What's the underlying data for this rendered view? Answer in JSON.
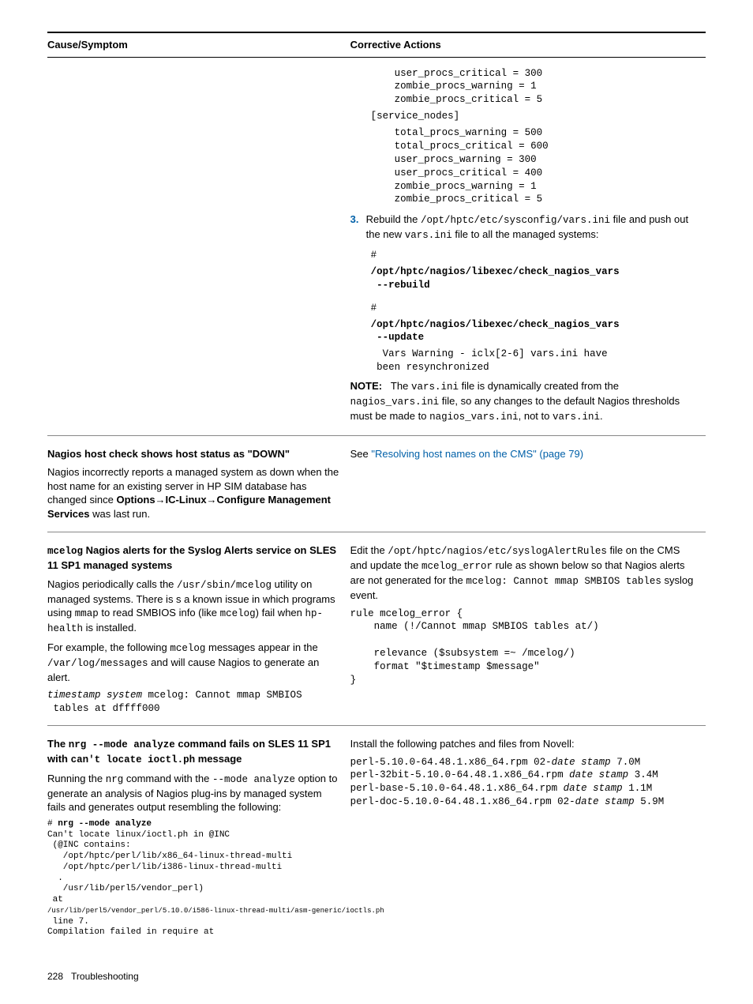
{
  "headers": {
    "cause": "Cause/Symptom",
    "actions": "Corrective Actions"
  },
  "row1": {
    "cfg1": "    user_procs_critical = 300\n    zombie_procs_warning = 1\n    zombie_procs_critical = 5",
    "section": "[service_nodes]",
    "cfg2": "    total_procs_warning = 500\n    total_procs_critical = 600\n    user_procs_warning = 300\n    user_procs_critical = 400\n    zombie_procs_warning = 1\n    zombie_procs_critical = 5",
    "step3a": "Rebuild the ",
    "step3path": "/opt/hptc/etc/sysconfig/vars.ini",
    "step3b": " file and push out the new ",
    "step3c": "vars.ini",
    "step3d": " file to all the managed systems:",
    "cmd1a": "#",
    "cmd1b": "/opt/hptc/nagios/libexec/check_nagios_vars\n --rebuild",
    "cmd2a": "#",
    "cmd2b": "/opt/hptc/nagios/libexec/check_nagios_vars\n --update",
    "cmd2out": "  Vars Warning - iclx[2-6] vars.ini have\n been resynchronized",
    "noteLabel": "NOTE:",
    "note1": "The ",
    "noteCode1": "vars.ini",
    "note2": " file is dynamically created from the ",
    "noteCode2": "nagios_vars.ini",
    "note3": " file, so any changes to the default Nagios thresholds must be made to ",
    "noteCode3": "nagios_vars.ini",
    "note4": ", not to ",
    "noteCode4": "vars.ini",
    "note5": "."
  },
  "row2": {
    "title": "Nagios host check shows host status as \"DOWN\"",
    "p1a": "Nagios incorrectly reports a managed system as down when the host name for an existing server in HP SIM database has changed since ",
    "p1bold": "Options→IC-Linux→Configure Management Services",
    "p1b": " was last run.",
    "action1": "See ",
    "actionLink": "\"Resolving host names on the CMS\" (page 79)"
  },
  "row3": {
    "titleCode": "mcelog",
    "titleRest": " Nagios alerts for the Syslog Alerts service on SLES 11 SP1 managed systems",
    "p1a": "Nagios periodically calls the ",
    "p1code1": "/usr/sbin/mcelog",
    "p1b": " utility on managed systems. There is s a known issue in which programs using ",
    "p1code2": "mmap",
    "p1c": " to read SMBIOS info (like ",
    "p1code3": "mcelog",
    "p1d": ") fail when ",
    "p1code4": "hp-health",
    "p1e": " is installed.",
    "p2a": "For example, the following ",
    "p2code1": "mcelog",
    "p2b": " messages appear in the ",
    "p2code2": "/var/log/messages",
    "p2c": " and will cause Nagios to generate an alert.",
    "msg": "timestamp system mcelog: Cannot mmap SMBIOS\n tables at dffff000",
    "msgItalic": "timestamp system",
    "a1a": "Edit the ",
    "a1code1": "/opt/hptc/nagios/etc/syslogAlertRules",
    "a1b": " file on the CMS and update the ",
    "a1code2": "mcelog_error",
    "a1c": " rule as shown below so that Nagios alerts are not generated for the ",
    "a1code3": "mcelog: Cannot mmap SMBIOS tables",
    "a1d": " syslog event.",
    "rule": "rule mcelog_error {\n    name (!/Cannot mmap SMBIOS tables at/)\n\n    relevance ($subsystem =~ /mcelog/)\n    format \"$timestamp $message\"\n}"
  },
  "row4": {
    "title1": "The ",
    "titleCode1": "nrg --mode analyze",
    "title2": " command fails on SLES 11 SP1 with ",
    "titleCode2": "can't locate ioctl.ph",
    "title3": " message",
    "p1a": "Running the ",
    "p1code1": "nrg",
    "p1b": " command with the ",
    "p1code2": "--mode analyze",
    "p1c": " option to generate an analysis of Nagios plug-ins by managed system fails and generates output resembling the following:",
    "cmd": "# nrg --mode analyze",
    "out": "Can't locate linux/ioctl.ph in @INC\n (@INC contains:\n   /opt/hptc/perl/lib/x86_64-linux-thread-multi\n   /opt/hptc/perl/lib/i386-linux-thread-multi\n  .\n   /usr/lib/perl5/vendor_perl)\n at\n/usr/lib/perl5/vendor_perl/5.10.0/i586-linux-thread-multi/asm-generic/ioctls.ph\n line 7.\nCompilation failed in require at",
    "a1": "Install the following patches and files from Novell:",
    "pkg1a": "perl-5.10.0-64.48.1.x86_64.rpm 02-",
    "pkg1i": "date stamp",
    "pkg1b": " 7.0M",
    "pkg2a": "perl-32bit-5.10.0-64.48.1.x86_64.rpm ",
    "pkg2i": "date stamp",
    "pkg2b": " 3.4M",
    "pkg3a": "perl-base-5.10.0-64.48.1.x86_64.rpm ",
    "pkg3i": "date stamp",
    "pkg3b": " 1.1M",
    "pkg4a": "perl-doc-5.10.0-64.48.1.x86_64.rpm 02-",
    "pkg4i": "date stamp",
    "pkg4b": " 5.9M"
  },
  "footer": {
    "pageNum": "228",
    "section": "Troubleshooting"
  }
}
